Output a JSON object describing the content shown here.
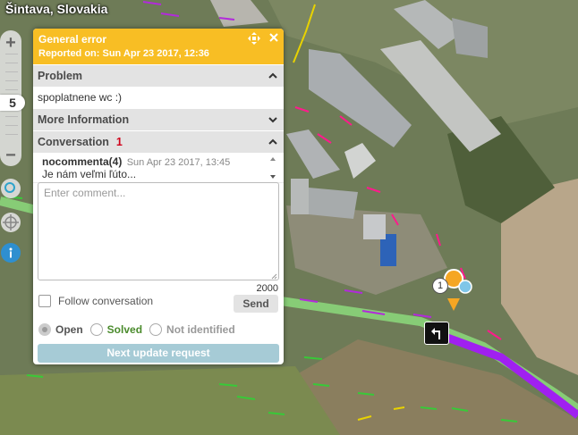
{
  "map": {
    "location": "Šintava, Slovakia",
    "zoom": {
      "plus": "+",
      "minus": "−",
      "level": "5"
    },
    "marker": {
      "count": "1"
    }
  },
  "panel": {
    "title": "General error",
    "reported": "Reported on: Sun Apr 23 2017, 12:36",
    "sections": {
      "problem": "Problem",
      "more_info": "More Information",
      "conversation": "Conversation",
      "conversation_count": "1"
    },
    "problem_text": "spoplatnene wc :)",
    "conversation": {
      "author": "nocommenta(4)",
      "date": "Sun Apr 23 2017, 13:45",
      "body": "Je nám veľmi ľúto..."
    },
    "comment": {
      "placeholder": "Enter comment...",
      "max": "2000"
    },
    "follow_label": "Follow conversation",
    "send_label": "Send",
    "status": {
      "open": "Open",
      "solved": "Solved",
      "not_identified": "Not identified",
      "selected": "Open"
    },
    "next_label": "Next update request"
  },
  "colors": {
    "header": "#f8be24",
    "road_highlight": "#8ad57a",
    "route": "#a020f0",
    "solved": "#4a8b2c"
  }
}
